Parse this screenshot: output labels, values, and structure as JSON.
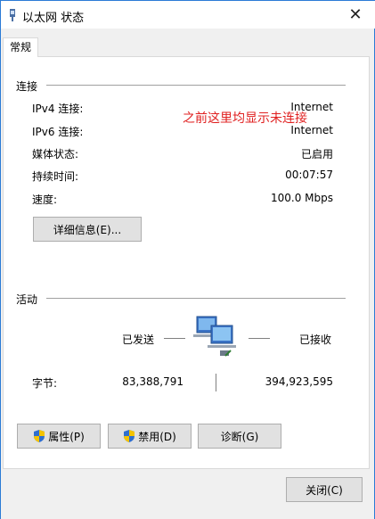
{
  "window": {
    "title": "以太网 状态",
    "close_glyph": "✕"
  },
  "tab": {
    "label": "常规"
  },
  "connection": {
    "section_title": "连接",
    "rows": [
      {
        "label": "IPv4 连接:",
        "value": "Internet"
      },
      {
        "label": "IPv6 连接:",
        "value": "Internet"
      },
      {
        "label": "媒体状态:",
        "value": "已启用"
      },
      {
        "label": "持续时间:",
        "value": "00:07:57"
      },
      {
        "label": "速度:",
        "value": "100.0 Mbps"
      }
    ],
    "details_button": "详细信息(E)..."
  },
  "annotation": "之前这里均显示未连接",
  "activity": {
    "section_title": "活动",
    "sent_label": "已发送",
    "received_label": "已接收",
    "bytes_label": "字节:",
    "bytes_sent": "83,388,791",
    "bytes_received": "394,923,595"
  },
  "buttons": {
    "properties": "属性(P)",
    "disable": "禁用(D)",
    "diagnose": "诊断(G)",
    "close": "关闭(C)"
  },
  "colors": {
    "accent": "#2b7bd6",
    "annotation": "#e02020"
  }
}
